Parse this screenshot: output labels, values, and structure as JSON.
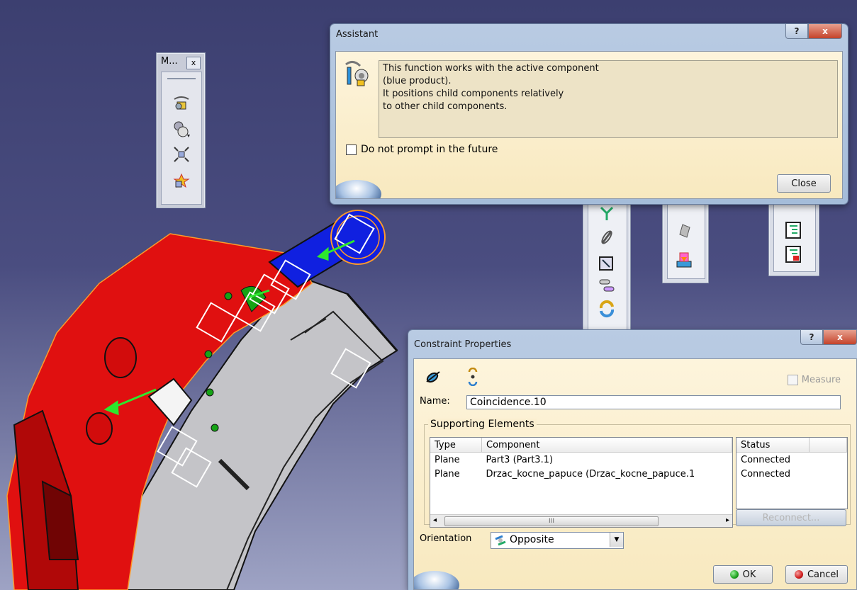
{
  "mini_toolbar": {
    "title": "M...",
    "close_glyph": "x",
    "icons": [
      "manipulation-icon",
      "snap-icon",
      "explode-icon",
      "clash-icon"
    ]
  },
  "assistant": {
    "title": "Assistant",
    "help_glyph": "?",
    "close_glyph": "x",
    "icon": "assembly-wizard-icon",
    "message_lines": [
      "This function works with the active component",
      "(blue product).",
      "It positions child components relatively",
      "to other child components."
    ],
    "checkbox_label": "Do not prompt in the future",
    "checkbox_checked": false,
    "close_button": "Close"
  },
  "constraint_properties": {
    "title": "Constraint Properties",
    "help_glyph": "?",
    "close_glyph": "x",
    "icons": [
      "coincidence-icon",
      "rotation-icon"
    ],
    "measure_label": "Measure",
    "measure_checked": false,
    "name_label": "Name:",
    "name_value": "Coincidence.10",
    "supporting_label": "Supporting Elements",
    "columns": {
      "type": "Type",
      "component": "Component",
      "status": "Status"
    },
    "rows": [
      {
        "type": "Plane",
        "component": "Part3 (Part3.1)",
        "status": "Connected"
      },
      {
        "type": "Plane",
        "component": "Drzac_kocne_papuce (Drzac_kocne_papuce.1",
        "status": "Connected"
      }
    ],
    "scroll_thumb_glyph": "III",
    "reconnect_button": "Reconnect...",
    "orientation_label": "Orientation",
    "orientation_value": "Opposite",
    "ok_button": "OK",
    "cancel_button": "Cancel",
    "colors": {
      "ok": "#1fa31f",
      "cancel": "#d11f1f"
    }
  },
  "colors": {
    "part_red": "#e01010",
    "part_blue": "#1020e0",
    "part_gray": "#c4c4c8",
    "background": "#3c3f70"
  }
}
